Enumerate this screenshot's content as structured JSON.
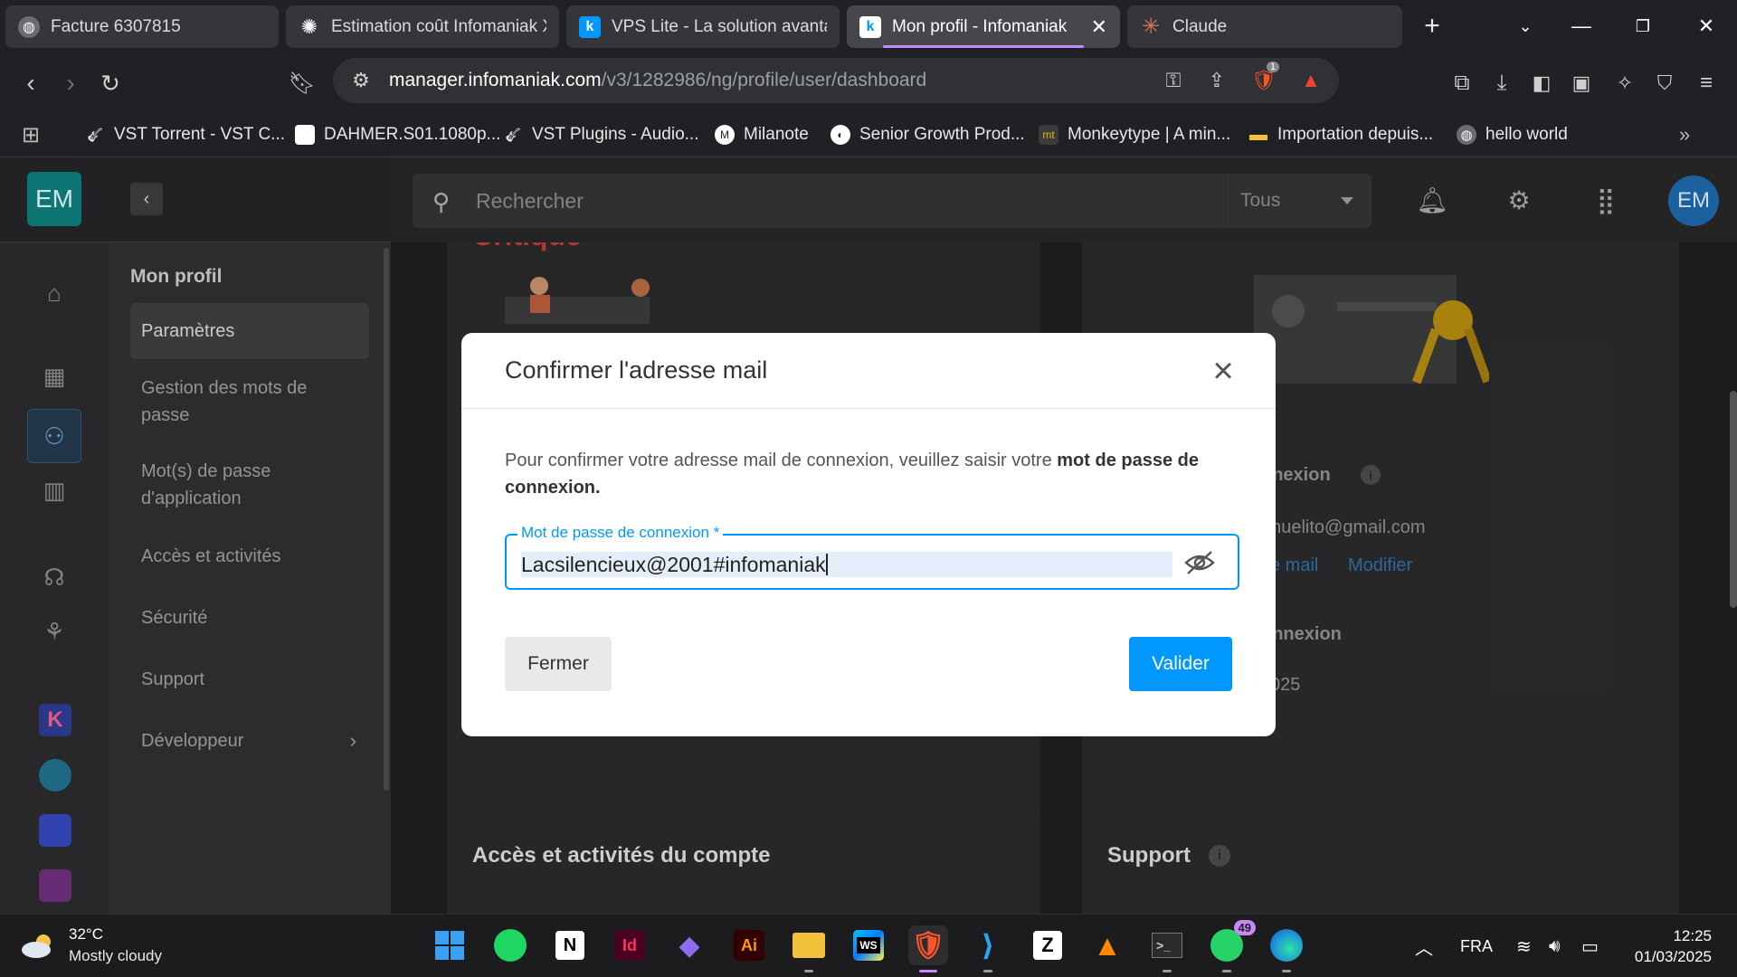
{
  "browser": {
    "tabs": [
      {
        "title": "Facture 6307815",
        "icon": "globe-icon"
      },
      {
        "title": "Estimation coût Infomaniak X",
        "icon": "openai-icon"
      },
      {
        "title": "VPS Lite - La solution avantag",
        "icon": "infomaniak-icon"
      },
      {
        "title": "Mon profil - Infomaniak",
        "icon": "infomaniak-icon",
        "active": true
      },
      {
        "title": "Claude",
        "icon": "claude-icon"
      }
    ],
    "url_host": "manager.infomaniak.com",
    "url_path": "/v3/1282986/ng/profile/user/dashboard",
    "brave_badge": "1",
    "bookmarks": [
      {
        "label": "VST Torrent - VST C..."
      },
      {
        "label": "DAHMER.S01.1080p..."
      },
      {
        "label": "VST Plugins - Audio..."
      },
      {
        "label": "Milanote"
      },
      {
        "label": "Senior Growth Prod..."
      },
      {
        "label": "Monkeytype | A min..."
      },
      {
        "label": "Importation depuis..."
      },
      {
        "label": "hello world"
      }
    ],
    "accent_color": "#c58af9"
  },
  "app": {
    "account_initials": "EM",
    "sidebar": {
      "title": "Mon profil",
      "items": [
        {
          "label": "Paramètres",
          "selected": true
        },
        {
          "label": "Gestion des mots de passe"
        },
        {
          "label": "Mot(s) de passe d'application"
        },
        {
          "label": "Accès et activités"
        },
        {
          "label": "Sécurité"
        },
        {
          "label": "Support"
        },
        {
          "label": "Développeur"
        }
      ]
    },
    "search": {
      "placeholder": "Rechercher",
      "filter": "Tous"
    },
    "background": {
      "critical_label": "Critique",
      "login_heading": "nnexion",
      "email_fragment": "anuelito@gmail.com",
      "link_mail": "e mail",
      "link_modify": "Modifier",
      "login_heading2": "onnexion",
      "date_fragment": "025",
      "card_access_title": "Accès et activités du compte",
      "card_support_title": "Support"
    }
  },
  "modal": {
    "title": "Confirmer l'adresse mail",
    "text_before": "Pour confirmer votre adresse mail de connexion, veuillez saisir votre ",
    "text_bold": "mot de passe de connexion.",
    "field_label": "Mot de passe de connexion *",
    "field_value": "Lacsilencieux@2001#infomaniak",
    "close_label": "Fermer",
    "submit_label": "Valider",
    "primary_color": "#0098ff"
  },
  "taskbar": {
    "weather_temp": "32°C",
    "weather_cond": "Mostly cloudy",
    "whatsapp_badge": "49",
    "language": "FRA",
    "time": "12:25",
    "date": "01/03/2025"
  }
}
